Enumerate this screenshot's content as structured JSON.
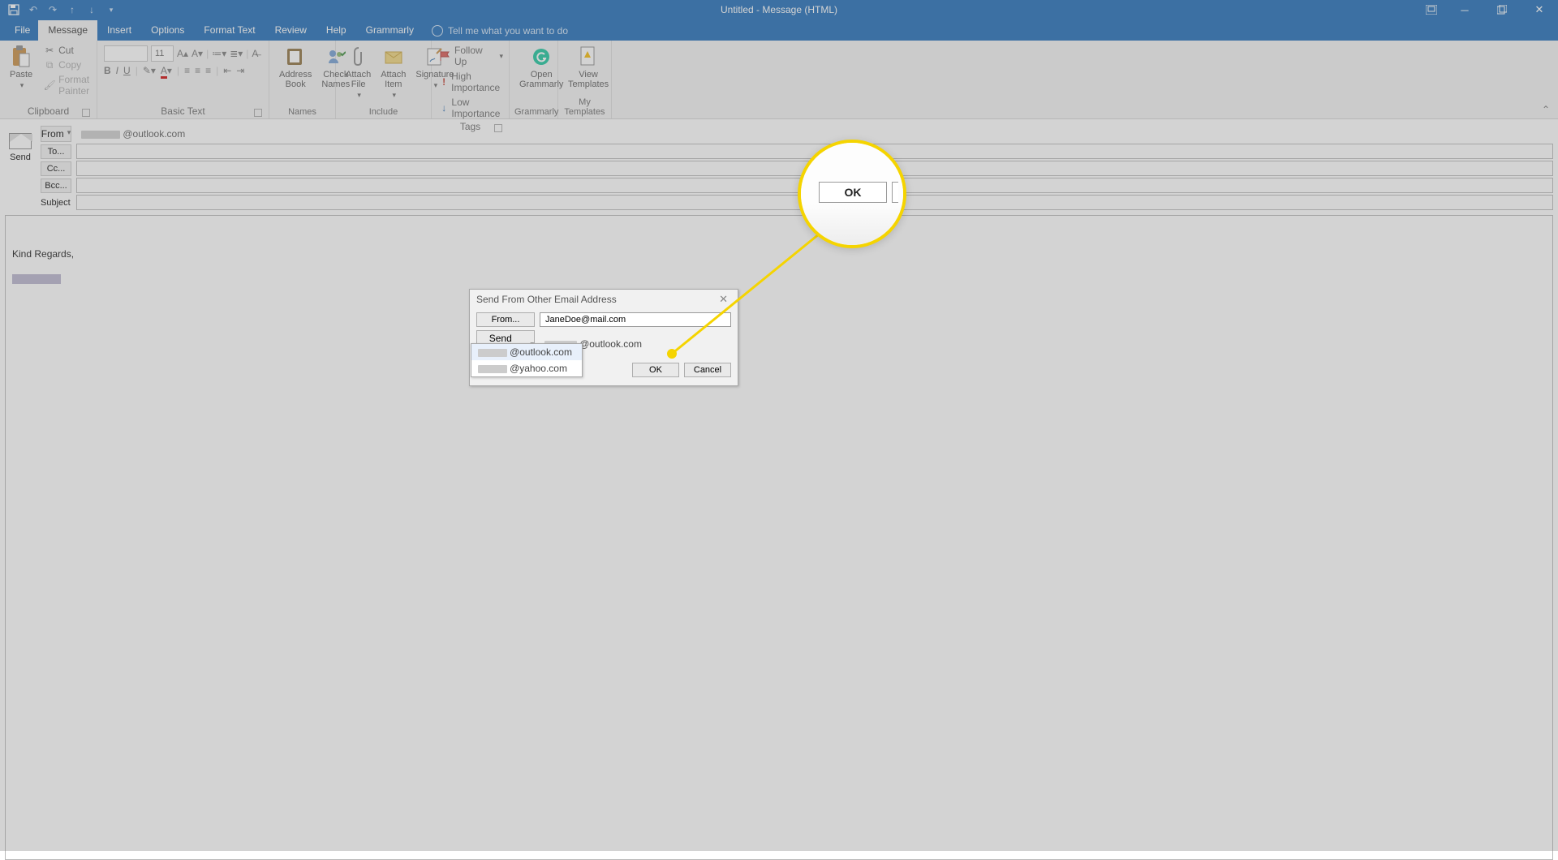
{
  "window": {
    "title": "Untitled  -  Message (HTML)"
  },
  "tabs": {
    "file": "File",
    "message": "Message",
    "insert": "Insert",
    "options": "Options",
    "formatText": "Format Text",
    "review": "Review",
    "help": "Help",
    "grammarly": "Grammarly",
    "tell": "Tell me what you want to do"
  },
  "ribbon": {
    "clipboard": {
      "label": "Clipboard",
      "paste": "Paste",
      "cut": "Cut",
      "copy": "Copy",
      "formatPainter": "Format Painter"
    },
    "basicText": {
      "label": "Basic Text",
      "fontSize": "11"
    },
    "names": {
      "label": "Names",
      "addressBook": "Address\nBook",
      "checkNames": "Check\nNames"
    },
    "include": {
      "label": "Include",
      "attachFile": "Attach\nFile",
      "attachItem": "Attach\nItem",
      "signature": "Signature"
    },
    "tags": {
      "label": "Tags",
      "followUp": "Follow Up",
      "highImportance": "High Importance",
      "lowImportance": "Low Importance"
    },
    "grammarly": {
      "label": "Grammarly",
      "open": "Open\nGrammarly"
    },
    "myTemplates": {
      "label": "My Templates",
      "view": "View\nTemplates"
    }
  },
  "compose": {
    "send": "Send",
    "from": "From",
    "fromValue": "@outlook.com",
    "to": "To...",
    "cc": "Cc...",
    "bcc": "Bcc...",
    "subject": "Subject"
  },
  "body": {
    "signature": "Kind Regards,"
  },
  "dialog": {
    "title": "Send From Other Email Address",
    "fromBtn": "From...",
    "fromValue": "JaneDoe@mail.com",
    "sendUsing": "Send Using",
    "sendUsingValue": "@outlook.com",
    "ok": "OK",
    "cancel": "Cancel",
    "options": [
      "@outlook.com",
      "@yahoo.com"
    ]
  },
  "callout": {
    "ok": "OK"
  }
}
